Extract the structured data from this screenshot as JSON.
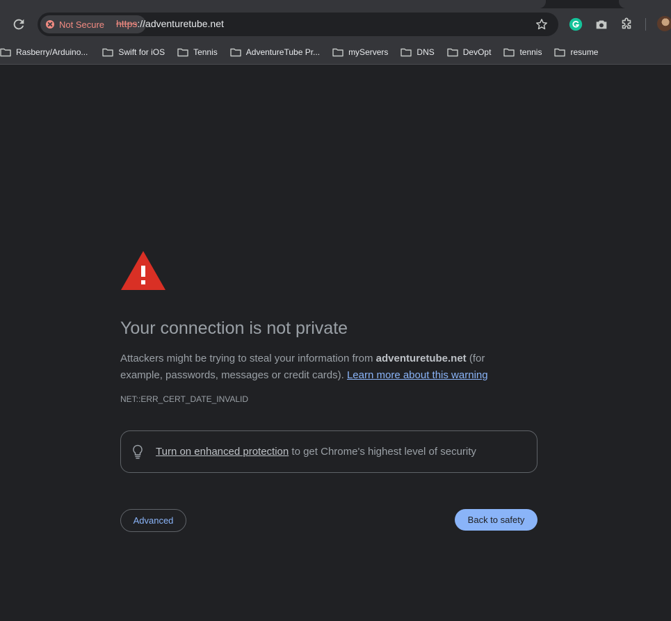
{
  "browser": {
    "security_chip": "Not Secure",
    "url_scheme": "https",
    "url_rest": "://adventuretube.net"
  },
  "bookmarks": [
    {
      "label": "Rasberry/Arduino..."
    },
    {
      "label": "Swift for iOS"
    },
    {
      "label": "Tennis"
    },
    {
      "label": "AdventureTube Pr..."
    },
    {
      "label": "myServers"
    },
    {
      "label": "DNS"
    },
    {
      "label": "DevOpt"
    },
    {
      "label": "tennis"
    },
    {
      "label": "resume"
    }
  ],
  "page": {
    "heading": "Your connection is not private",
    "desc_before": "Attackers might be trying to steal your information from ",
    "domain": "adventuretube.net",
    "desc_after": " (for example, passwords, messages or credit cards). ",
    "learn_more": "Learn more about this warning",
    "error_code": "NET::ERR_CERT_DATE_INVALID",
    "protection_link": "Turn on enhanced protection",
    "protection_text": " to get Chrome's highest level of security",
    "advanced_label": "Advanced",
    "back_label": "Back to safety"
  },
  "colors": {
    "warning_red": "#d93025",
    "link_blue": "#8ab4f8",
    "grammarly_green": "#15c39a"
  }
}
